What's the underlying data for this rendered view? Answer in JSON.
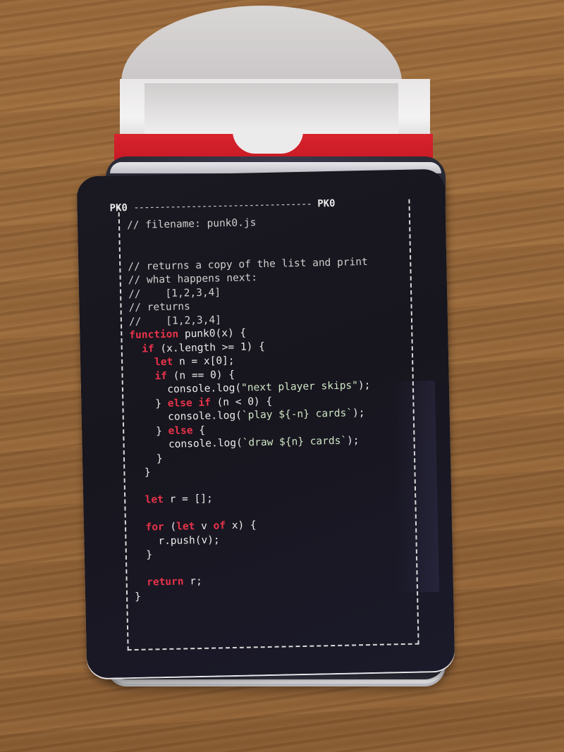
{
  "card": {
    "label_left": "PK0",
    "label_right": "PK0",
    "dashes": "----------------------------------",
    "code_lines": [
      {
        "indent": "",
        "parts": [
          {
            "t": "cm",
            "v": "// filename: punk0.js"
          }
        ]
      },
      {
        "indent": "",
        "parts": []
      },
      {
        "indent": "",
        "parts": []
      },
      {
        "indent": "",
        "parts": [
          {
            "t": "cm",
            "v": "// returns a copy of the list and print"
          }
        ]
      },
      {
        "indent": "",
        "parts": [
          {
            "t": "cm",
            "v": "// what happens next:"
          }
        ]
      },
      {
        "indent": "",
        "parts": [
          {
            "t": "cm",
            "v": "//    [1,2,3,4]"
          }
        ]
      },
      {
        "indent": "",
        "parts": [
          {
            "t": "cm",
            "v": "// returns"
          }
        ]
      },
      {
        "indent": "",
        "parts": [
          {
            "t": "cm",
            "v": "//    [1,2,3,4]"
          }
        ]
      },
      {
        "indent": "",
        "parts": [
          {
            "t": "kw",
            "v": "function"
          },
          {
            "t": "tx",
            "v": " punk0(x) {"
          }
        ]
      },
      {
        "indent": "  ",
        "parts": [
          {
            "t": "kw",
            "v": "if"
          },
          {
            "t": "tx",
            "v": " (x.length >= 1) {"
          }
        ]
      },
      {
        "indent": "    ",
        "parts": [
          {
            "t": "kw",
            "v": "let"
          },
          {
            "t": "tx",
            "v": " n = x[0];"
          }
        ]
      },
      {
        "indent": "    ",
        "parts": [
          {
            "t": "kw",
            "v": "if"
          },
          {
            "t": "tx",
            "v": " (n == 0) {"
          }
        ]
      },
      {
        "indent": "      ",
        "parts": [
          {
            "t": "tx",
            "v": "console.log("
          },
          {
            "t": "st",
            "v": "\"next player skips\""
          },
          {
            "t": "tx",
            "v": ");"
          }
        ]
      },
      {
        "indent": "    ",
        "parts": [
          {
            "t": "tx",
            "v": "} "
          },
          {
            "t": "kw",
            "v": "else if"
          },
          {
            "t": "tx",
            "v": " (n < 0) {"
          }
        ]
      },
      {
        "indent": "      ",
        "parts": [
          {
            "t": "tx",
            "v": "console.log("
          },
          {
            "t": "st",
            "v": "`play ${-n} cards`"
          },
          {
            "t": "tx",
            "v": ");"
          }
        ]
      },
      {
        "indent": "    ",
        "parts": [
          {
            "t": "tx",
            "v": "} "
          },
          {
            "t": "kw",
            "v": "else"
          },
          {
            "t": "tx",
            "v": " {"
          }
        ]
      },
      {
        "indent": "      ",
        "parts": [
          {
            "t": "tx",
            "v": "console.log("
          },
          {
            "t": "st",
            "v": "`draw ${n} cards`"
          },
          {
            "t": "tx",
            "v": ");"
          }
        ]
      },
      {
        "indent": "    ",
        "parts": [
          {
            "t": "tx",
            "v": "}"
          }
        ]
      },
      {
        "indent": "  ",
        "parts": [
          {
            "t": "tx",
            "v": "}"
          }
        ]
      },
      {
        "indent": "",
        "parts": []
      },
      {
        "indent": "  ",
        "parts": [
          {
            "t": "kw",
            "v": "let"
          },
          {
            "t": "tx",
            "v": " r = [];"
          }
        ]
      },
      {
        "indent": "",
        "parts": []
      },
      {
        "indent": "  ",
        "parts": [
          {
            "t": "kw",
            "v": "for"
          },
          {
            "t": "tx",
            "v": " ("
          },
          {
            "t": "kw",
            "v": "let"
          },
          {
            "t": "tx",
            "v": " v "
          },
          {
            "t": "kw",
            "v": "of"
          },
          {
            "t": "tx",
            "v": " x) {"
          }
        ]
      },
      {
        "indent": "    ",
        "parts": [
          {
            "t": "tx",
            "v": "r.push(v);"
          }
        ]
      },
      {
        "indent": "  ",
        "parts": [
          {
            "t": "tx",
            "v": "}"
          }
        ]
      },
      {
        "indent": "",
        "parts": []
      },
      {
        "indent": "  ",
        "parts": [
          {
            "t": "kw",
            "v": "return"
          },
          {
            "t": "tx",
            "v": " r;"
          }
        ]
      },
      {
        "indent": "",
        "parts": [
          {
            "t": "tx",
            "v": "}"
          }
        ]
      }
    ]
  },
  "colors": {
    "keyword": "#e8334a",
    "comment": "#cfd0cf",
    "string": "#cfe6c6",
    "card_bg": "#1a1821",
    "box_red": "#d8232d"
  }
}
